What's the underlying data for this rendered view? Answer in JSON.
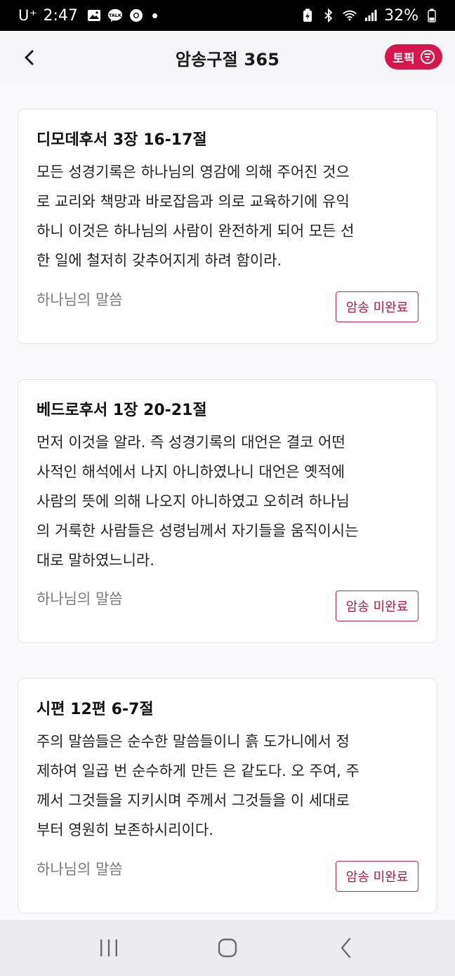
{
  "status_bar": {
    "carrier": "U⁺",
    "time": "2:47",
    "talk_badge": "TALK",
    "battery": "32%",
    "icons": [
      "gallery-icon",
      "kakaotalk-icon",
      "chrome-icon",
      "notification-dot",
      "battery-saver-icon",
      "bluetooth-icon",
      "wifi-icon",
      "signal-icon",
      "battery-icon"
    ]
  },
  "header": {
    "title": "암송구절 365",
    "topic_label": "토픽",
    "back_icon": "chevron-left-icon",
    "topic_icon": "filter-icon"
  },
  "accent_color": "#d6174e",
  "cards": [
    {
      "reference": "디모데후서 3장 16-17절",
      "lines": [
        "모든 성경기록은 하나님의 영감에 의해 주어진 것으",
        "로 교리와 책망과 바로잡음과 의로 교육하기에 유익",
        "하니 이것은 하나님의 사람이 완전하게 되어 모든 선",
        "한 일에 철저히 갖추어지게 하려 함이라."
      ],
      "source": "하나님의 말씀",
      "status": "암송 미완료"
    },
    {
      "reference": "베드로후서 1장 20-21절",
      "lines": [
        "먼저 이것을 알라. 즉 성경기록의 대언은 결코 어떤",
        "사적인 해석에서 나지 아니하였나니 대언은 옛적에",
        "사람의 뜻에 의해 나오지 아니하였고 오히려 하나님",
        "의 거룩한 사람들은 성령님께서 자기들을 움직이시는",
        "대로 말하였느니라."
      ],
      "source": "하나님의 말씀",
      "status": "암송 미완료"
    },
    {
      "reference": "시편 12편 6-7절",
      "lines": [
        "주의 말씀들은 순수한 말씀들이니 흙 도가니에서 정",
        "제하여 일곱 번 순수하게 만든 은 같도다. 오 주여, 주",
        "께서 그것들을 지키시며 주께서 그것들을 이 세대로",
        "부터 영원히 보존하시리이다."
      ],
      "source": "하나님의 말씀",
      "status": "암송 미완료"
    }
  ],
  "nav_bar": {
    "icons": [
      "recent-apps-icon",
      "home-icon",
      "back-icon"
    ]
  }
}
